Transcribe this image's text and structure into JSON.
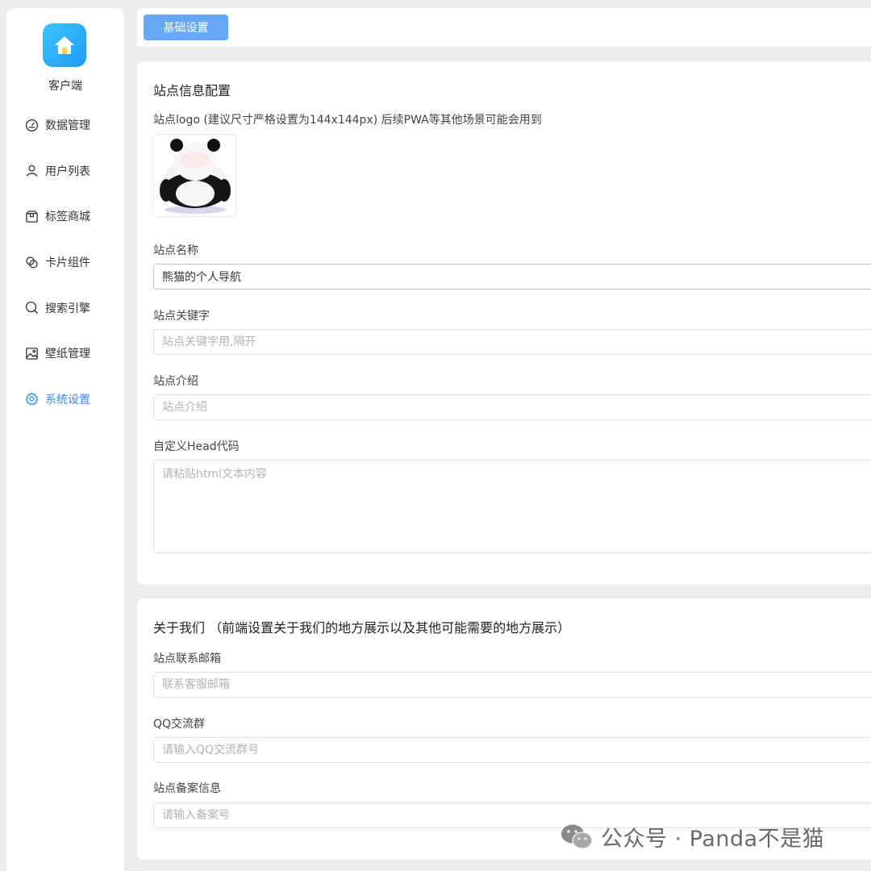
{
  "sidebar": {
    "brand": "客户端",
    "items": [
      {
        "label": "数据管理",
        "icon": "dashboard-icon"
      },
      {
        "label": "用户列表",
        "icon": "user-icon"
      },
      {
        "label": "标签商城",
        "icon": "box-icon"
      },
      {
        "label": "卡片组件",
        "icon": "cards-icon"
      },
      {
        "label": "搜索引擎",
        "icon": "search-icon"
      },
      {
        "label": "壁纸管理",
        "icon": "image-icon"
      },
      {
        "label": "系统设置",
        "icon": "gear-icon",
        "active": true
      }
    ]
  },
  "tabs": {
    "basic": "基础设置"
  },
  "site_info": {
    "title": "站点信息配置",
    "logo_label": "站点logo (建议尺寸严格设置为144x144px) 后续PWA等其他场景可能会用到",
    "name_label": "站点名称",
    "name_value": "熊猫的个人导航",
    "keywords_label": "站点关键字",
    "keywords_placeholder": "站点关键字用,隔开",
    "intro_label": "站点介绍",
    "intro_placeholder": "站点介绍",
    "head_label": "自定义Head代码",
    "head_placeholder": "请粘贴html文本内容"
  },
  "about": {
    "title": "关于我们 （前端设置关于我们的地方展示以及其他可能需要的地方展示）",
    "email_label": "站点联系邮箱",
    "email_placeholder": "联系客服邮箱",
    "qq_label": "QQ交流群",
    "qq_placeholder": "请输入QQ交流群号",
    "icp_label": "站点备案信息",
    "icp_placeholder": "请输入备案号"
  },
  "watermark": "公众号 · Panda不是猫",
  "colors": {
    "accent": "#3a8ee6",
    "tab_bg": "#66a8f5",
    "logo_gradient": [
      "#3ec2ff",
      "#1e9cf5"
    ]
  }
}
